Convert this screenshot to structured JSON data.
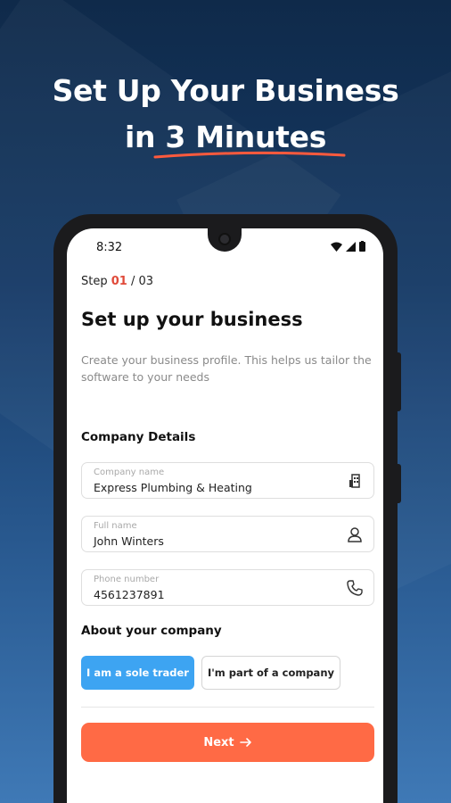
{
  "promo": {
    "headline_line1": "Set Up Your Business",
    "headline_line2": "in 3 Minutes",
    "accent_color": "#ff5a3d"
  },
  "status_bar": {
    "time": "8:32"
  },
  "step": {
    "label": "Step",
    "current": "01",
    "separator": "/",
    "total": "03"
  },
  "page": {
    "title": "Set up your business",
    "subtitle": "Create your business profile. This helps us tailor the software to your needs"
  },
  "company_details": {
    "heading": "Company Details",
    "fields": [
      {
        "label": "Company name",
        "value": "Express Plumbing & Heating",
        "icon": "building-icon"
      },
      {
        "label": "Full name",
        "value": "John Winters",
        "icon": "user-icon"
      },
      {
        "label": "Phone number",
        "value": "4561237891",
        "icon": "phone-icon"
      }
    ]
  },
  "about_company": {
    "heading": "About your company",
    "options": [
      {
        "label": "I am a sole trader",
        "selected": true
      },
      {
        "label": "I'm part of a company",
        "selected": false
      }
    ]
  },
  "actions": {
    "next_label": "Next",
    "next_color": "#ff6a45"
  },
  "colors": {
    "selected_option": "#3da4f2",
    "step_current": "#e04a3a"
  }
}
